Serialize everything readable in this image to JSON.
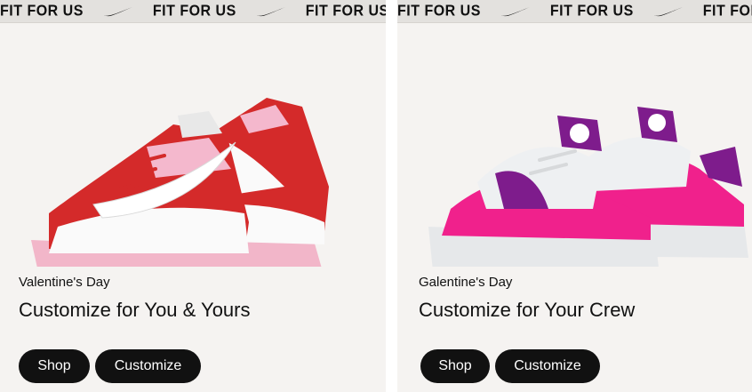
{
  "cards": [
    {
      "banner_text": "FIT FOR US",
      "eyebrow": "Valentine's Day",
      "headline": "Customize for You & Yours",
      "shop_label": "Shop",
      "customize_label": "Customize",
      "shoe_icon": "red-pink-high-top-sneaker",
      "colors": {
        "primary": "#d42a2a",
        "secondary": "#f4b8cd",
        "base": "#fafafa"
      }
    },
    {
      "banner_text": "FIT FOR US",
      "eyebrow": "Galentine's Day",
      "headline": "Customize for Your Crew",
      "shop_label": "Shop",
      "customize_label": "Customize",
      "shoe_icon": "pink-purple-runner-sneaker",
      "colors": {
        "primary": "#f0218c",
        "secondary": "#7e1c8c",
        "base": "#eef0f2"
      }
    }
  ]
}
